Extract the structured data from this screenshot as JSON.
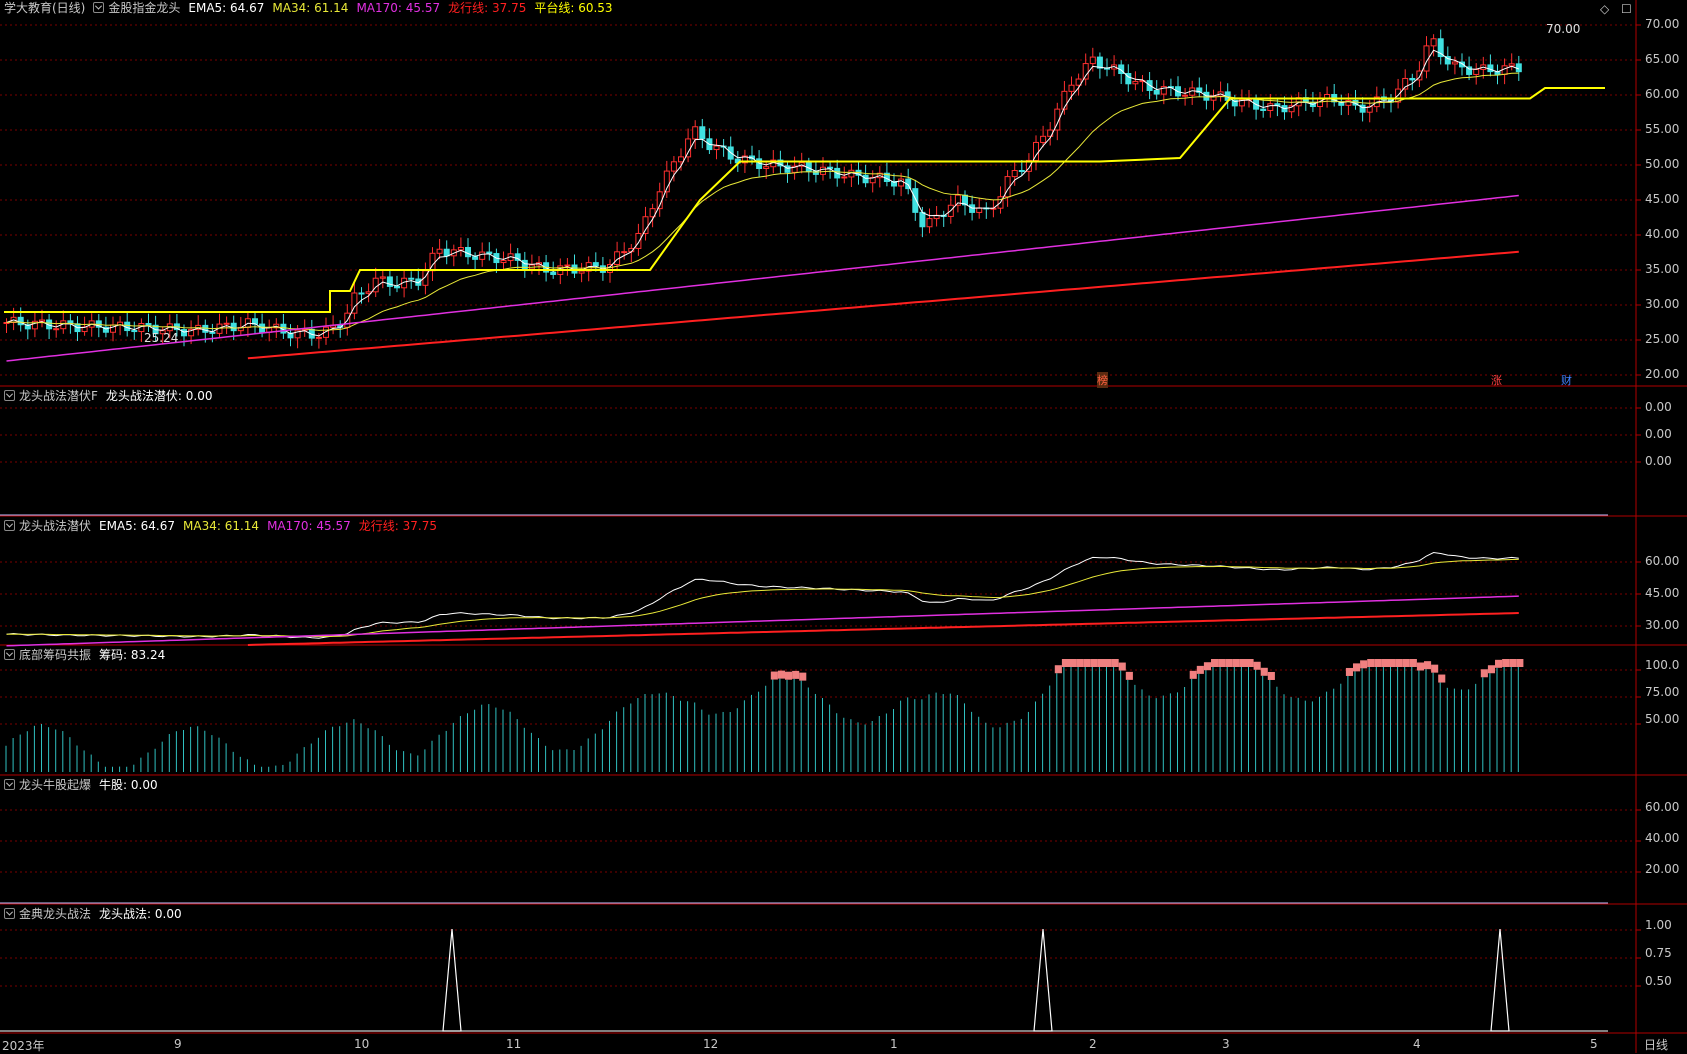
{
  "panels": [
    {
      "id": "main",
      "title": "学大教育(日线)",
      "indicator_name": "金股指金龙头",
      "values": [
        {
          "label": "EMA5: 64.67",
          "color": "#ffffff"
        },
        {
          "label": "MA34: 61.14",
          "color": "#e8e838"
        },
        {
          "label": "MA170: 45.57",
          "color": "#e030e0"
        },
        {
          "label": "龙行线: 37.75",
          "color": "#ff2020"
        },
        {
          "label": "平台线: 60.53",
          "color": "#ffff00"
        }
      ],
      "y_ticks": [
        "70.00",
        "65.00",
        "60.00",
        "55.00",
        "50.00",
        "45.00",
        "40.00",
        "35.00",
        "30.00",
        "25.00",
        "20.00"
      ],
      "annotations": {
        "high": "70.00",
        "low": "25.24"
      },
      "markers": [
        {
          "text": "榜",
          "color": "#ff6040"
        },
        {
          "text": "涨",
          "color": "#ff4040"
        },
        {
          "text": "财",
          "color": "#4080ff"
        }
      ]
    },
    {
      "id": "p2",
      "title": "龙头战法潜伏F",
      "values": [
        {
          "label": "龙头战法潜伏: 0.00",
          "color": "#ffffff"
        }
      ],
      "y_ticks": [
        "0.00",
        "0.00",
        "0.00"
      ]
    },
    {
      "id": "p3",
      "title": "龙头战法潜伏",
      "values": [
        {
          "label": "EMA5: 64.67",
          "color": "#ffffff"
        },
        {
          "label": "MA34: 61.14",
          "color": "#e8e838"
        },
        {
          "label": "MA170: 45.57",
          "color": "#e030e0"
        },
        {
          "label": "龙行线: 37.75",
          "color": "#ff2020"
        }
      ],
      "y_ticks": [
        "60.00",
        "45.00",
        "30.00"
      ]
    },
    {
      "id": "p4",
      "title": "底部筹码共振",
      "values": [
        {
          "label": "筹码: 83.24",
          "color": "#ffffff"
        }
      ],
      "y_ticks": [
        "100.0",
        "75.00",
        "50.00"
      ]
    },
    {
      "id": "p5",
      "title": "龙头牛股起爆",
      "values": [
        {
          "label": "牛股: 0.00",
          "color": "#ffffff"
        }
      ],
      "y_ticks": [
        "60.00",
        "40.00",
        "20.00"
      ]
    },
    {
      "id": "p6",
      "title": "金典龙头战法",
      "values": [
        {
          "label": "龙头战法: 0.00",
          "color": "#ffffff"
        }
      ],
      "y_ticks": [
        "1.00",
        "0.75",
        "0.50"
      ]
    }
  ],
  "x_axis": [
    "2023年",
    "9",
    "10",
    "11",
    "12",
    "1",
    "2",
    "3",
    "4",
    "5"
  ],
  "period": "日线",
  "corner_icons": "◇ ☐",
  "colors": {
    "up": "#ff3030",
    "down": "#40e0e0",
    "grid": "#7a0000",
    "axis": "#b00000"
  }
}
